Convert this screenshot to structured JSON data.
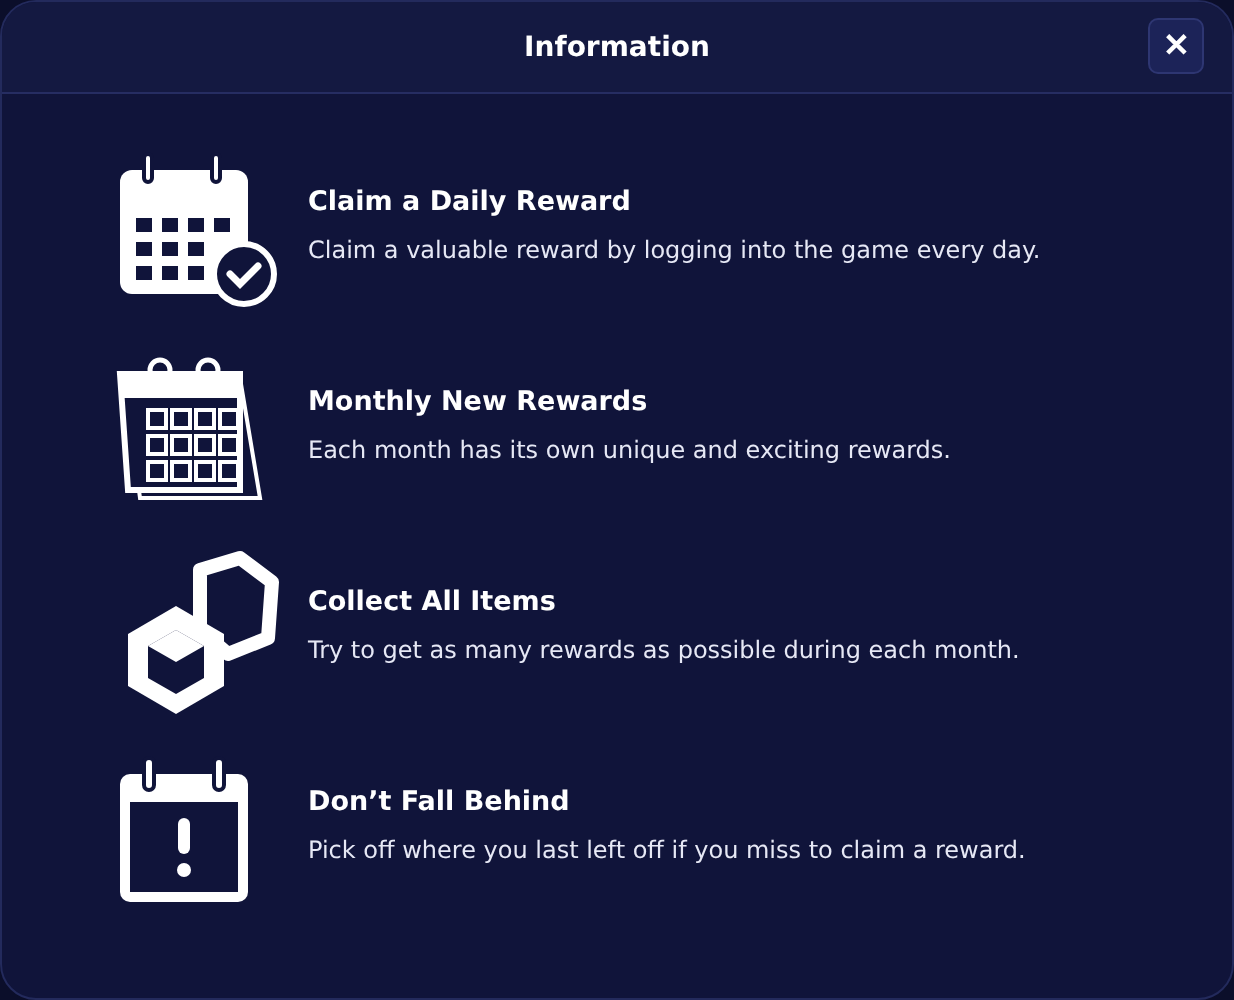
{
  "window": {
    "title": "Information",
    "close_label": "✕"
  },
  "items": [
    {
      "kind": "calendar-check",
      "title": "Claim a Daily Reward",
      "text": "Claim a valuable reward by logging into the game every day."
    },
    {
      "kind": "calendar-pages",
      "title": "Monthly New Rewards",
      "text": "Each month has its own unique and exciting rewards."
    },
    {
      "kind": "cubes",
      "title": "Collect All Items",
      "text": "Try to get as many rewards as possible during each month."
    },
    {
      "kind": "calendar-alert",
      "title": "Don’t Fall Behind",
      "text": "Pick off where you last left off if you miss to claim a reward."
    }
  ]
}
